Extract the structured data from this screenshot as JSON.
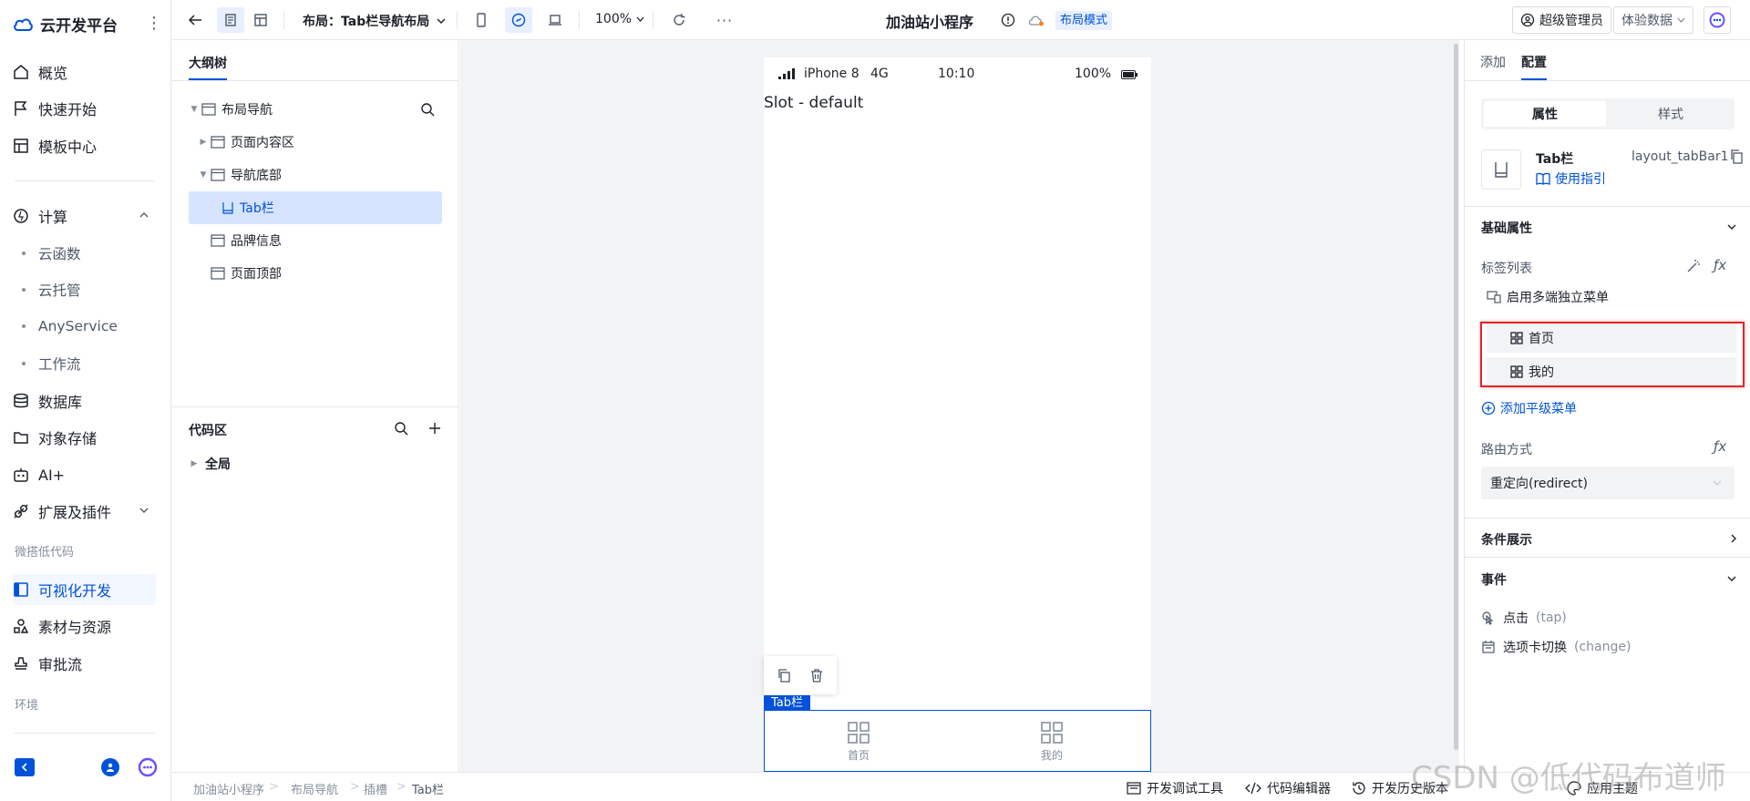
{
  "brand": {
    "title": "云开发平台"
  },
  "nav": {
    "overview": "概览",
    "quickstart": "快速开始",
    "templates": "模板中心",
    "compute": "计算",
    "cloud_functions": "云函数",
    "cloud_hosting": "云托管",
    "any_service": "AnyService",
    "workflow": "工作流",
    "database": "数据库",
    "object_storage": "对象存储",
    "ai_plus": "AI+",
    "extensions": "扩展及插件",
    "section_lowcode": "微搭低代码",
    "visual_dev": "可视化开发",
    "materials": "素材与资源",
    "approval": "审批流",
    "section_env": "环境"
  },
  "toolbar": {
    "layout_label": "布局：Tab栏导航布局",
    "zoom": "100%",
    "app_title": "加油站小程序",
    "mode_badge": "布局模式",
    "admin": "超级管理员",
    "trial_data": "体验数据"
  },
  "outline": {
    "tab": "大纲树",
    "tree": [
      {
        "label": "布局导航"
      },
      {
        "label": "页面内容区"
      },
      {
        "label": "导航底部"
      },
      {
        "label": "Tab栏"
      },
      {
        "label": "品牌信息"
      },
      {
        "label": "页面顶部"
      }
    ],
    "code_title": "代码区",
    "code_global": "全局"
  },
  "phone": {
    "carrier": "iPhone 8",
    "network": "4G",
    "time": "10:10",
    "battery": "100%",
    "slot_text": "Slot - default",
    "tabbar_label": "Tab栏",
    "tabs": [
      {
        "label": "首页"
      },
      {
        "label": "我的"
      }
    ]
  },
  "right": {
    "tab_add": "添加",
    "tab_config": "配置",
    "seg_props": "属性",
    "seg_style": "样式",
    "comp_name": "Tab栏",
    "comp_id": "layout_tabBar1",
    "usage_guide": "使用指引",
    "basic_props": "基础属性",
    "tag_list": "标签列表",
    "multi_menu": "启用多端独立菜单",
    "menu_items": [
      {
        "label": "首页"
      },
      {
        "label": "我的"
      }
    ],
    "add_menu": "添加平级菜单",
    "route_mode": "路由方式",
    "route_value": "重定向(redirect)",
    "conditional": "条件展示",
    "events": "事件",
    "event_click": "点击",
    "event_click_code": "(tap)",
    "event_change": "选项卡切换",
    "event_change_code": "(change)"
  },
  "footer": {
    "crumbs": [
      "加油站小程序",
      "布局导航",
      "插槽",
      "Tab栏"
    ],
    "debug_tool": "开发调试工具",
    "code_editor": "代码编辑器",
    "history": "开发历史版本",
    "theme": "应用主题"
  },
  "watermark": "CSDN @低代码布道师",
  "colors": {
    "primary": "#0052d9",
    "highlight_box": "#e0262b"
  }
}
